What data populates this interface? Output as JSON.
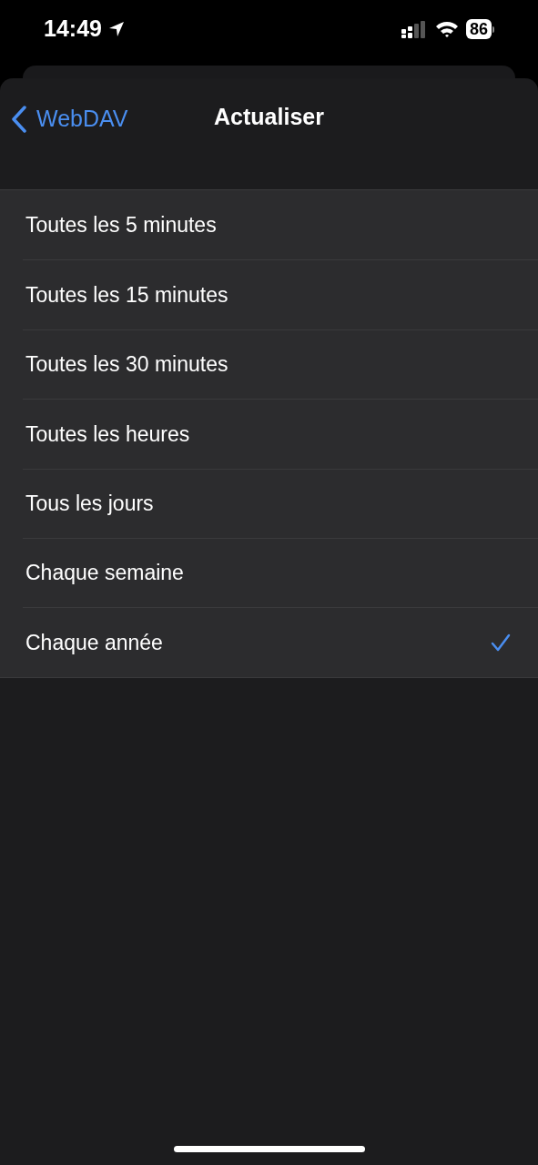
{
  "status_bar": {
    "time": "14:49",
    "battery": "86"
  },
  "nav": {
    "back": "WebDAV",
    "title": "Actualiser"
  },
  "options": [
    {
      "label": "Toutes les 5 minutes",
      "selected": false
    },
    {
      "label": "Toutes les 15 minutes",
      "selected": false
    },
    {
      "label": "Toutes les 30 minutes",
      "selected": false
    },
    {
      "label": "Toutes les heures",
      "selected": false
    },
    {
      "label": "Tous les jours",
      "selected": false
    },
    {
      "label": "Chaque semaine",
      "selected": false
    },
    {
      "label": "Chaque année",
      "selected": true
    }
  ]
}
